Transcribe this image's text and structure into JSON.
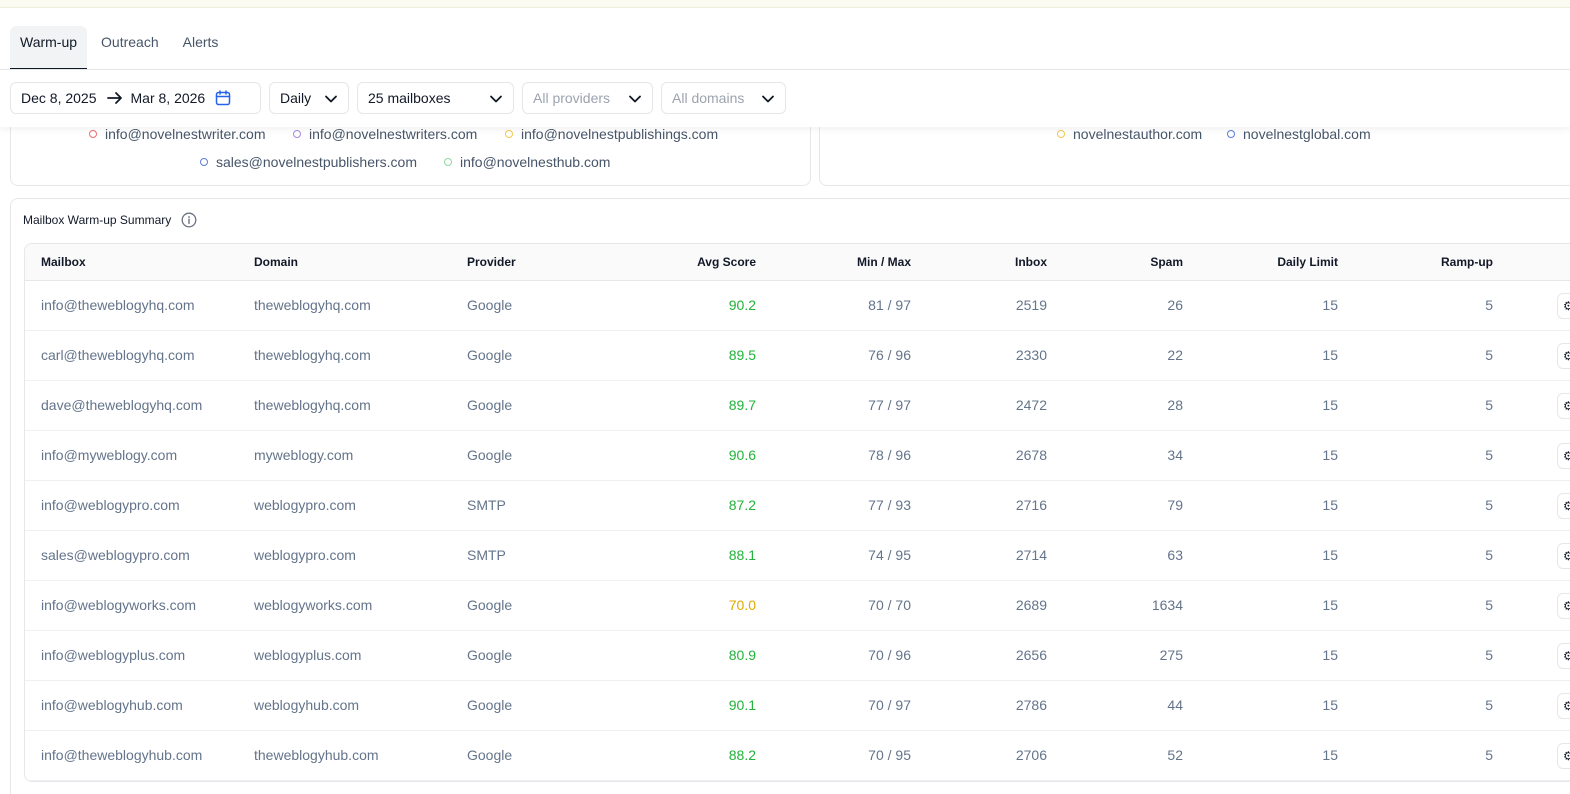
{
  "tabs": [
    {
      "label": "Warm-up",
      "active": true
    },
    {
      "label": "Outreach",
      "active": false
    },
    {
      "label": "Alerts",
      "active": false
    }
  ],
  "filters": {
    "date_from": "Dec 8, 2025",
    "date_to": "Mar 8, 2026",
    "interval": "Daily",
    "mailboxes": "25 mailboxes",
    "providers_placeholder": "All providers",
    "domains_placeholder": "All domains"
  },
  "legend_left": [
    {
      "label": "info@novelnestwriter.com",
      "color": "#ef6b73"
    },
    {
      "label": "info@novelnestwriters.com",
      "color": "#a78bdb"
    },
    {
      "label": "info@novelnestpublishings.com",
      "color": "#f2c94c"
    },
    {
      "label": "sales@novelnestpublishers.com",
      "color": "#5b7fd6"
    },
    {
      "label": "info@novelnesthub.com",
      "color": "#8fd6a3"
    }
  ],
  "legend_right": [
    {
      "label": "novelnestauthor.com",
      "color": "#f2c94c"
    },
    {
      "label": "novelnestglobal.com",
      "color": "#5b7fd6"
    }
  ],
  "summary": {
    "title": "Mailbox Warm-up Summary",
    "columns": [
      "Mailbox",
      "Domain",
      "Provider",
      "Avg Score",
      "Min / Max",
      "Inbox",
      "Spam",
      "Daily Limit",
      "Ramp-up"
    ],
    "rows": [
      {
        "mailbox": "info@theweblogyhq.com",
        "domain": "theweblogyhq.com",
        "provider": "Google",
        "avg": "90.2",
        "minmax": "81 / 97",
        "inbox": "2519",
        "spam": "26",
        "limit": "15",
        "ramp": "5",
        "status": "green"
      },
      {
        "mailbox": "carl@theweblogyhq.com",
        "domain": "theweblogyhq.com",
        "provider": "Google",
        "avg": "89.5",
        "minmax": "76 / 96",
        "inbox": "2330",
        "spam": "22",
        "limit": "15",
        "ramp": "5",
        "status": "green"
      },
      {
        "mailbox": "dave@theweblogyhq.com",
        "domain": "theweblogyhq.com",
        "provider": "Google",
        "avg": "89.7",
        "minmax": "77 / 97",
        "inbox": "2472",
        "spam": "28",
        "limit": "15",
        "ramp": "5",
        "status": "green"
      },
      {
        "mailbox": "info@myweblogy.com",
        "domain": "myweblogy.com",
        "provider": "Google",
        "avg": "90.6",
        "minmax": "78 / 96",
        "inbox": "2678",
        "spam": "34",
        "limit": "15",
        "ramp": "5",
        "status": "green"
      },
      {
        "mailbox": "info@weblogypro.com",
        "domain": "weblogypro.com",
        "provider": "SMTP",
        "avg": "87.2",
        "minmax": "77 / 93",
        "inbox": "2716",
        "spam": "79",
        "limit": "15",
        "ramp": "5",
        "status": "green"
      },
      {
        "mailbox": "sales@weblogypro.com",
        "domain": "weblogypro.com",
        "provider": "SMTP",
        "avg": "88.1",
        "minmax": "74 / 95",
        "inbox": "2714",
        "spam": "63",
        "limit": "15",
        "ramp": "5",
        "status": "green"
      },
      {
        "mailbox": "info@weblogyworks.com",
        "domain": "weblogyworks.com",
        "provider": "Google",
        "avg": "70.0",
        "minmax": "70 / 70",
        "inbox": "2689",
        "spam": "1634",
        "limit": "15",
        "ramp": "5",
        "status": "amber"
      },
      {
        "mailbox": "info@weblogyplus.com",
        "domain": "weblogyplus.com",
        "provider": "Google",
        "avg": "80.9",
        "minmax": "70 / 96",
        "inbox": "2656",
        "spam": "275",
        "limit": "15",
        "ramp": "5",
        "status": "green"
      },
      {
        "mailbox": "info@weblogyhub.com",
        "domain": "weblogyhub.com",
        "provider": "Google",
        "avg": "90.1",
        "minmax": "70 / 97",
        "inbox": "2786",
        "spam": "44",
        "limit": "15",
        "ramp": "5",
        "status": "green"
      },
      {
        "mailbox": "info@theweblogyhub.com",
        "domain": "theweblogyhub.com",
        "provider": "Google",
        "avg": "88.2",
        "minmax": "70 / 95",
        "inbox": "2706",
        "spam": "52",
        "limit": "15",
        "ramp": "5",
        "status": "green"
      }
    ]
  },
  "colors": {
    "green": "#22b33a",
    "amber": "#e0a800",
    "accent": "#2563eb"
  }
}
